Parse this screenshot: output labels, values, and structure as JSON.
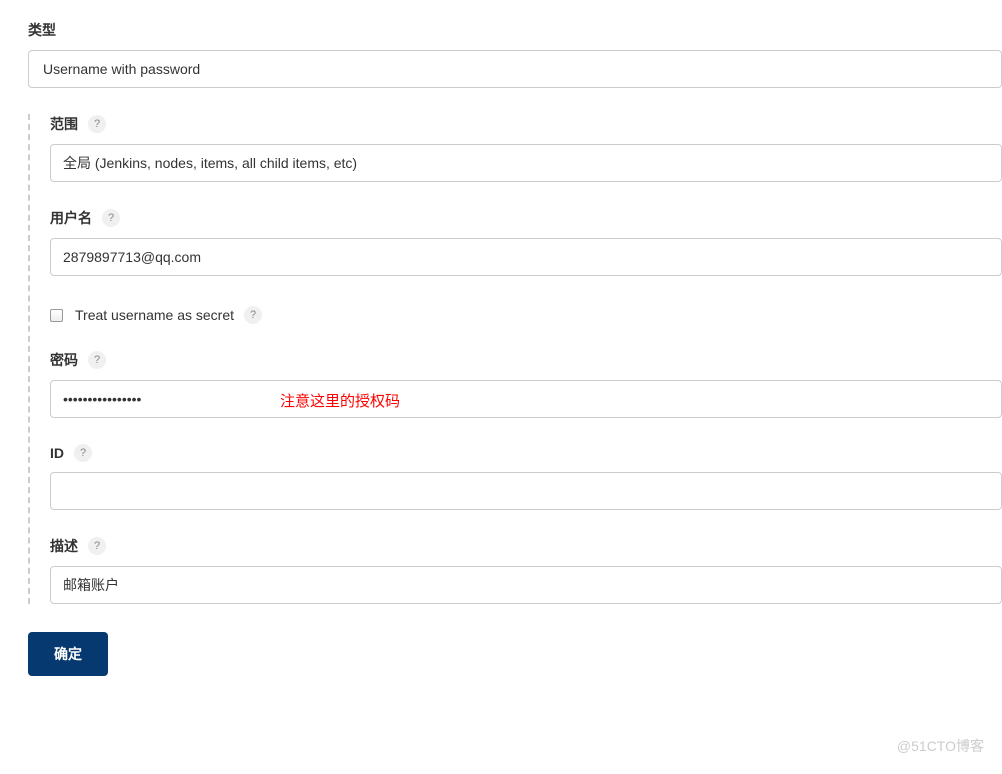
{
  "type_label": "类型",
  "type_value": "Username with password",
  "scope": {
    "label": "范围",
    "value": "全局 (Jenkins, nodes, items, all child items, etc)"
  },
  "username": {
    "label": "用户名",
    "value": "2879897713@qq.com"
  },
  "treat_secret": {
    "label": "Treat username as secret"
  },
  "password": {
    "label": "密码",
    "value": "••••••••••••••••",
    "annotation": "注意这里的授权码"
  },
  "id": {
    "label": "ID",
    "value": ""
  },
  "description": {
    "label": "描述",
    "value": "邮箱账户"
  },
  "help_char": "?",
  "submit_label": "确定",
  "watermark": "@51CTO博客"
}
